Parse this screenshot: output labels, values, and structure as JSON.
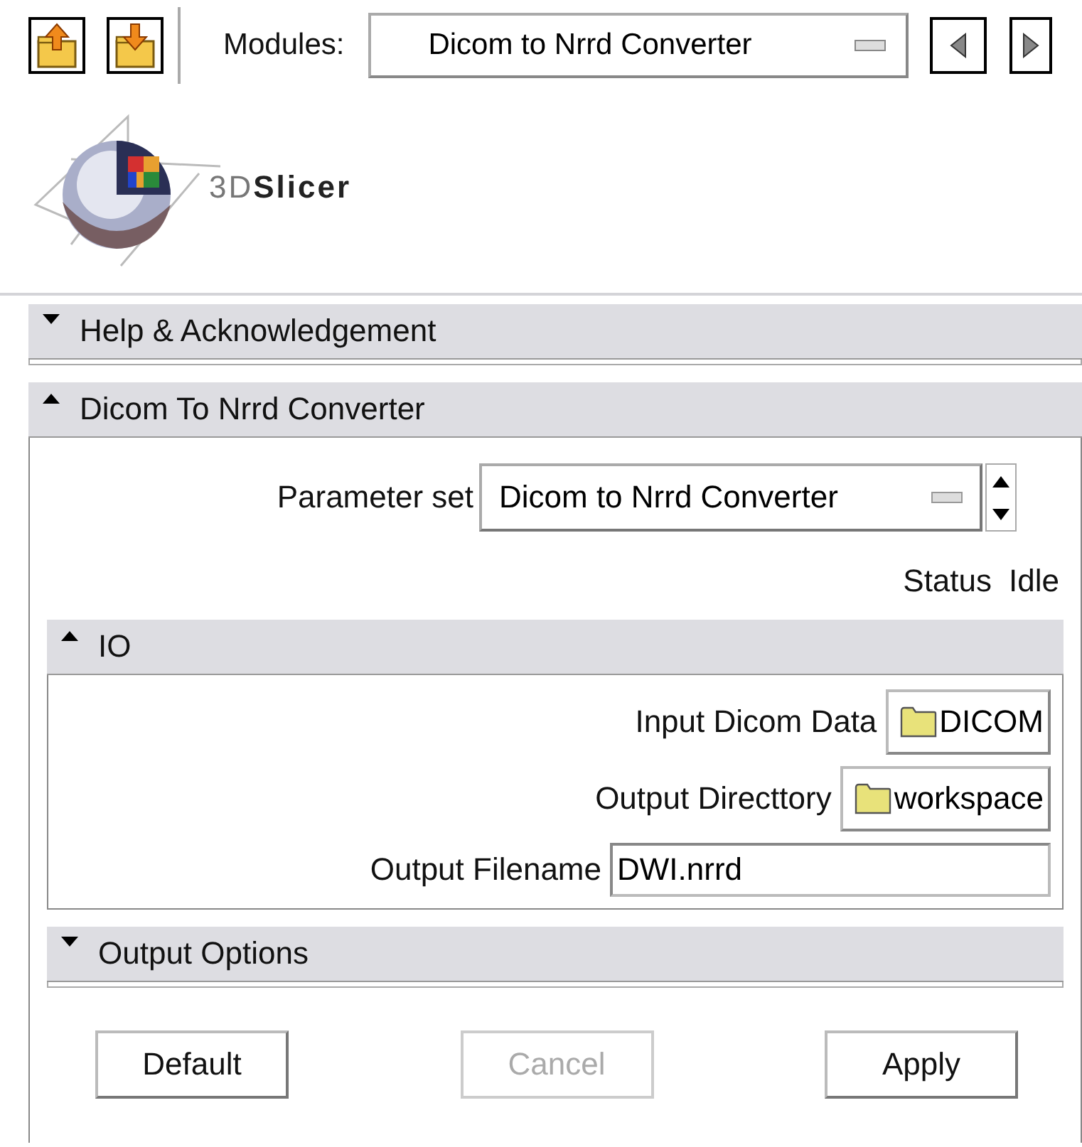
{
  "toolbar": {
    "modules_label": "Modules:",
    "module": "Dicom to Nrrd Converter"
  },
  "logo": {
    "text": "3D**Slicer**"
  },
  "help_section": {
    "title": "Help & Acknowledgement",
    "expanded": false
  },
  "module_section": {
    "title": "Dicom To Nrrd Converter",
    "expanded": true,
    "parameter_set": {
      "label": "Parameter set",
      "value": "Dicom to Nrrd Converter"
    },
    "status": {
      "label": "Status",
      "value": "Idle"
    },
    "io": {
      "title": "IO",
      "expanded": true,
      "rows": [
        {
          "kind": "directory",
          "label": "Input Dicom Data",
          "value": "DICOM"
        },
        {
          "kind": "directory",
          "label": "Output Directtory",
          "value": "workspace"
        },
        {
          "kind": "text",
          "label": "Output Filename",
          "value": "DWI.nrrd"
        }
      ]
    },
    "output_options": {
      "title": "Output Options",
      "expanded": false
    }
  },
  "buttons": [
    {
      "label": "Default",
      "disabled": false
    },
    {
      "label": "Cancel",
      "disabled": true
    },
    {
      "label": "Apply",
      "disabled": false
    }
  ]
}
